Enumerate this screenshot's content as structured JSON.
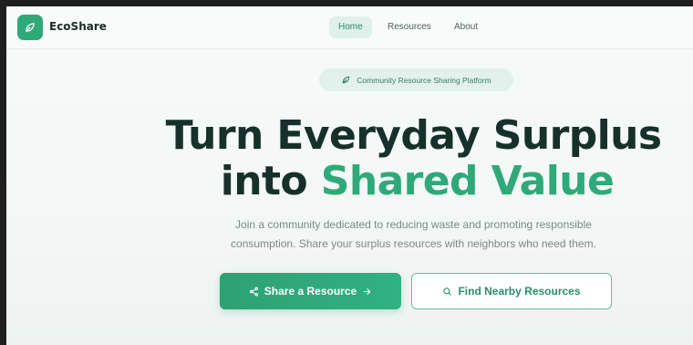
{
  "nav": {
    "brand": "EcoShare",
    "links": [
      {
        "label": "Home",
        "active": true
      },
      {
        "label": "Resources",
        "active": false
      },
      {
        "label": "About",
        "active": false
      }
    ]
  },
  "hero": {
    "badge": "Community Resource Sharing Platform",
    "title_line1": "Turn Everyday Surplus",
    "title_line2_prefix": "into ",
    "title_line2_accent": "Shared Value",
    "subtitle_line1": "Join a community dedicated to reducing waste and promoting responsible",
    "subtitle_line2": "consumption. Share your surplus resources with neighbors who need them.",
    "primary_button": "Share a Resource",
    "secondary_button": "Find Nearby Resources"
  },
  "icons": {
    "logo": "leaf-icon",
    "badge": "leaf-icon",
    "primary_left": "share-icon",
    "primary_right": "arrow-right-icon",
    "secondary_left": "search-icon"
  },
  "colors": {
    "accent": "#2fa97a",
    "heading": "#17302a",
    "text_muted": "#7c8985",
    "nav_active_bg": "#dff1ea"
  }
}
